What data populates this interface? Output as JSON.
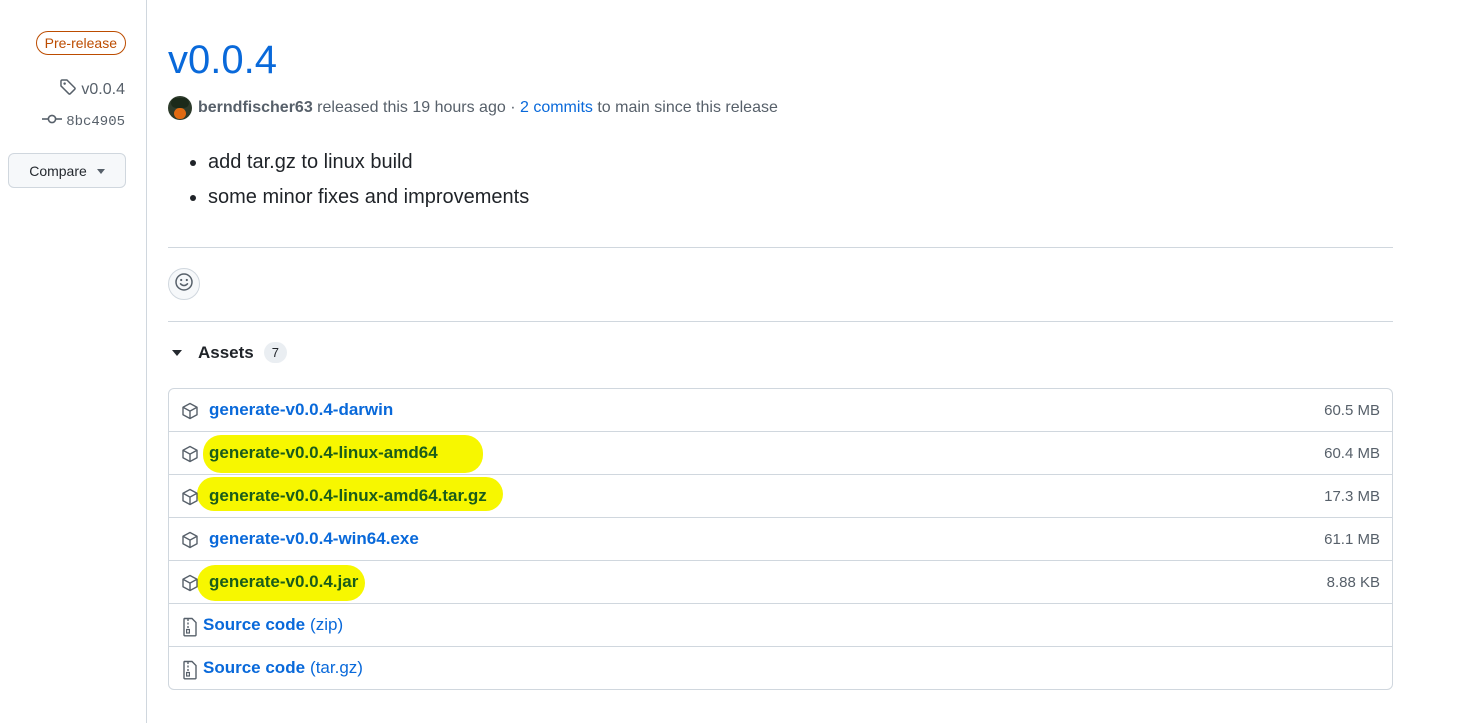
{
  "sidebar": {
    "badge": "Pre-release",
    "tag": "v0.0.4",
    "commit": "8bc4905",
    "compare_label": "Compare"
  },
  "release": {
    "title": "v0.0.4",
    "author": "berndfischer63",
    "released_text": "released this 19 hours ago",
    "separator": "·",
    "commits_link": "2 commits",
    "since_text": "to main since this release",
    "notes": [
      "add tar.gz to linux build",
      "some minor fixes and improvements"
    ]
  },
  "assets": {
    "label": "Assets",
    "count": "7",
    "items": [
      {
        "name": "generate-v0.0.4-darwin",
        "size": "60.5 MB",
        "highlighted": false
      },
      {
        "name": "generate-v0.0.4-linux-amd64",
        "size": "60.4 MB",
        "highlighted": true
      },
      {
        "name": "generate-v0.0.4-linux-amd64.tar.gz",
        "size": "17.3 MB",
        "highlighted": true
      },
      {
        "name": "generate-v0.0.4-win64.exe",
        "size": "61.1 MB",
        "highlighted": false
      },
      {
        "name": "generate-v0.0.4.jar",
        "size": "8.88 KB",
        "highlighted": true
      }
    ],
    "sources": [
      {
        "name": "Source code",
        "kind": "(zip)"
      },
      {
        "name": "Source code",
        "kind": "(tar.gz)"
      }
    ]
  },
  "colors": {
    "link": "#0969da",
    "highlight": "#f7f700",
    "prerelease": "#bc4c00"
  },
  "icons": [
    "tag-icon",
    "git-commit-icon",
    "triangle-down-icon",
    "smiley-icon",
    "package-icon",
    "file-zip-icon"
  ]
}
